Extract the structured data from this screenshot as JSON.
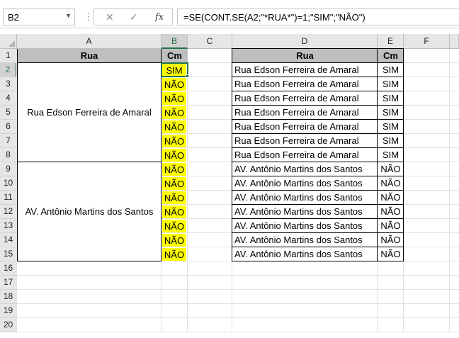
{
  "formula_bar": {
    "name_box": "B2",
    "cancel_icon": "✕",
    "enter_icon": "✓",
    "fx_label": "fx",
    "formula": "=SE(CONT.SE(A2;\"*RUA*\")=1;\"SIM\";\"NÃO\")"
  },
  "columns": [
    "A",
    "B",
    "C",
    "D",
    "E",
    "F"
  ],
  "rows": [
    "1",
    "2",
    "3",
    "4",
    "5",
    "6",
    "7",
    "8",
    "9",
    "10",
    "11",
    "12",
    "13",
    "14",
    "15",
    "16",
    "17",
    "18",
    "19",
    "20"
  ],
  "left_table": {
    "header_rua": "Rua",
    "header_cm": "Cm",
    "group1": "Rua Edson Ferreira de Amaral",
    "group2": "AV. Antônio Martins dos Santos",
    "cm_values": [
      "SIM",
      "NÃO",
      "NÃO",
      "NÃO",
      "NÃO",
      "NÃO",
      "NÃO",
      "NÃO",
      "NÃO",
      "NÃO",
      "NÃO",
      "NÃO",
      "NÃO",
      "NÃO"
    ]
  },
  "right_table": {
    "header_rua": "Rua",
    "header_cm": "Cm",
    "rows": [
      {
        "rua": "Rua Edson Ferreira de Amaral",
        "cm": "SIM"
      },
      {
        "rua": "Rua Edson Ferreira de Amaral",
        "cm": "SIM"
      },
      {
        "rua": "Rua Edson Ferreira de Amaral",
        "cm": "SIM"
      },
      {
        "rua": "Rua Edson Ferreira de Amaral",
        "cm": "SIM"
      },
      {
        "rua": "Rua Edson Ferreira de Amaral",
        "cm": "SIM"
      },
      {
        "rua": "Rua Edson Ferreira de Amaral",
        "cm": "SIM"
      },
      {
        "rua": "Rua Edson Ferreira de Amaral",
        "cm": "SIM"
      },
      {
        "rua": "AV. Antônio Martins dos Santos",
        "cm": "NÃO"
      },
      {
        "rua": "AV. Antônio Martins dos Santos",
        "cm": "NÃO"
      },
      {
        "rua": "AV. Antônio Martins dos Santos",
        "cm": "NÃO"
      },
      {
        "rua": "AV. Antônio Martins dos Santos",
        "cm": "NÃO"
      },
      {
        "rua": "AV. Antônio Martins dos Santos",
        "cm": "NÃO"
      },
      {
        "rua": "AV. Antônio Martins dos Santos",
        "cm": "NÃO"
      },
      {
        "rua": "AV. Antônio Martins dos Santos",
        "cm": "NÃO"
      }
    ]
  },
  "colors": {
    "header_fill": "#bfbfbf",
    "highlight_fill": "#ffff00",
    "selection": "#217346"
  }
}
